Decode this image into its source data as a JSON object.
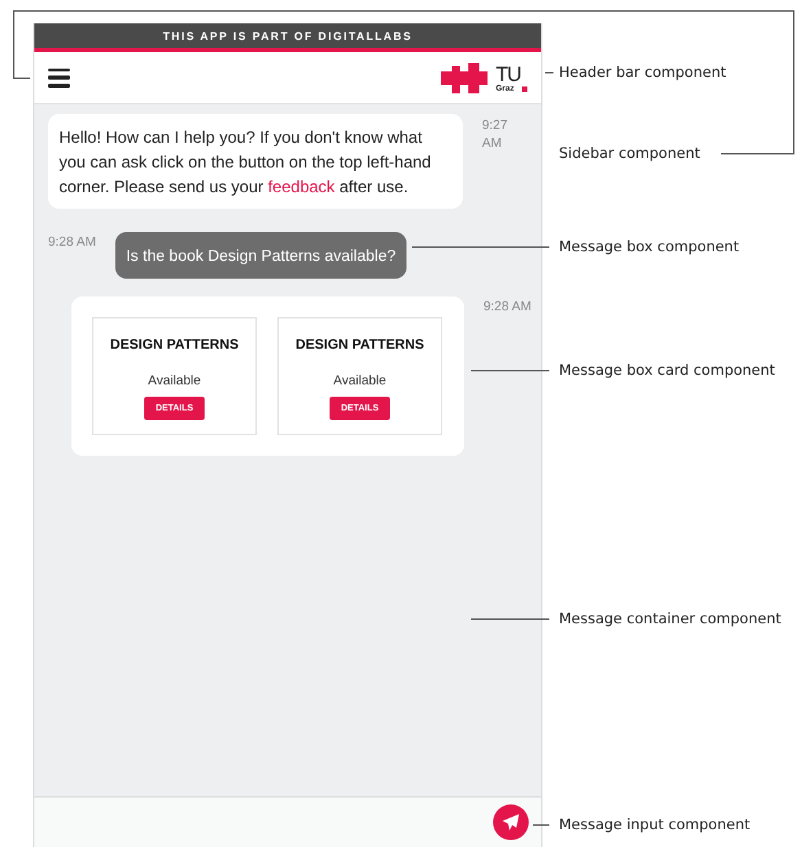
{
  "banner": {
    "text": "THIS APP IS PART OF DIGITALLABS"
  },
  "header": {
    "logo_text": "TU",
    "logo_subtext": "Graz"
  },
  "messages": [
    {
      "kind": "bot_text",
      "text_before": "Hello! How can I help you? If you don't know what you can ask click on the button on the top left-hand corner. Please send us your ",
      "link": "feedback",
      "text_after": " after use.",
      "time": "9:27 AM"
    },
    {
      "kind": "user_text",
      "text": "Is the book Design Patterns available?",
      "time": "9:28 AM"
    },
    {
      "kind": "bot_cards",
      "time": "9:28 AM",
      "cards": [
        {
          "title": "DESIGN PATTERNS",
          "status": "Available",
          "button": "DETAILS"
        },
        {
          "title": "DESIGN PATTERNS",
          "status": "Available",
          "button": "DETAILS"
        }
      ]
    }
  ],
  "annotations": [
    {
      "label": "Header bar component"
    },
    {
      "label": "Sidebar component"
    },
    {
      "label": "Message box component"
    },
    {
      "label": "Message box card component"
    },
    {
      "label": "Message container component"
    },
    {
      "label": "Message input component"
    }
  ]
}
